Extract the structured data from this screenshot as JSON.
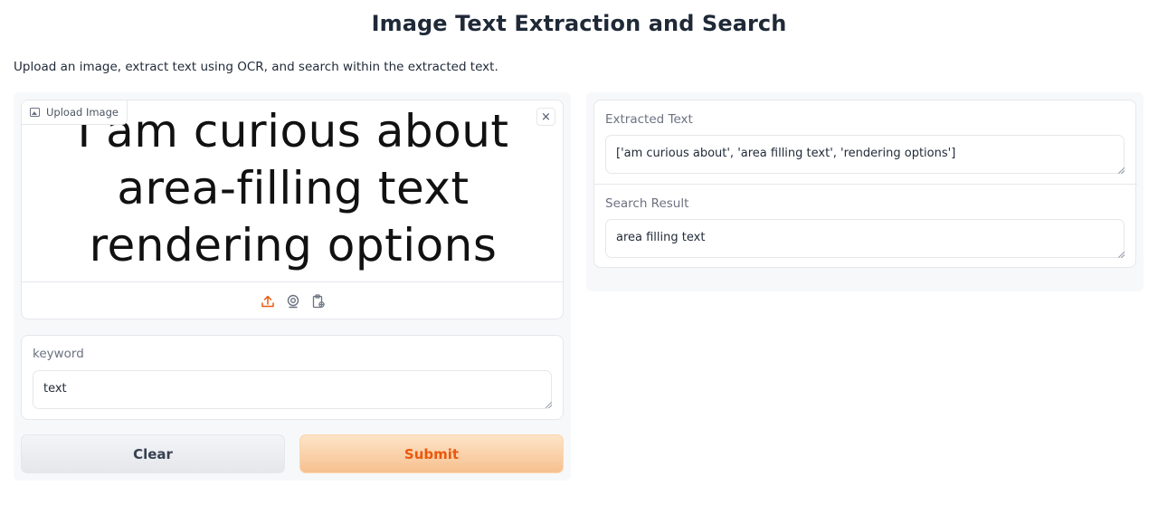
{
  "page": {
    "title": "Image Text Extraction and Search",
    "description": "Upload an image, extract text using OCR, and search within the extracted text."
  },
  "image_input": {
    "label": "Upload Image",
    "close_symbol": "×",
    "image_text_lines": [
      "I am curious about",
      "area-filling text",
      "rendering options"
    ],
    "toolbar_icons": [
      "upload-icon",
      "webcam-icon",
      "clipboard-icon"
    ],
    "accent_color": "#ea580c"
  },
  "keyword": {
    "label": "keyword",
    "value": "text"
  },
  "buttons": {
    "clear": "Clear",
    "submit": "Submit"
  },
  "outputs": {
    "extracted": {
      "label": "Extracted Text",
      "value": "['am curious about', 'area filling text', 'rendering options']"
    },
    "search": {
      "label": "Search Result",
      "value": "area filling text"
    }
  }
}
